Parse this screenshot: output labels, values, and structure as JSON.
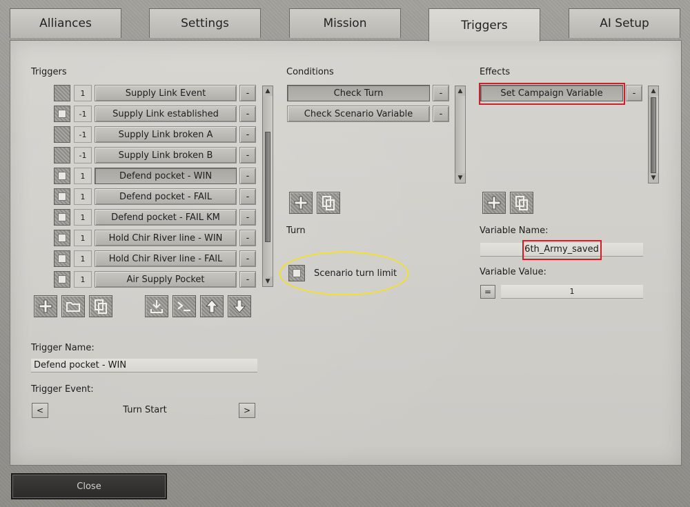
{
  "tabs": [
    {
      "label": "Alliances"
    },
    {
      "label": "Settings"
    },
    {
      "label": "Mission"
    },
    {
      "label": "Triggers",
      "active": true
    },
    {
      "label": "AI Setup"
    }
  ],
  "triggers": {
    "header": "Triggers",
    "rows": [
      {
        "checked": false,
        "count": "1",
        "name": "Supply Link Event",
        "remove": "-"
      },
      {
        "checked": true,
        "count": "-1",
        "name": "Supply Link established",
        "remove": "-"
      },
      {
        "checked": false,
        "count": "-1",
        "name": "Supply Link broken A",
        "remove": "-"
      },
      {
        "checked": false,
        "count": "-1",
        "name": "Supply Link broken B",
        "remove": "-"
      },
      {
        "checked": true,
        "count": "1",
        "name": "Defend pocket - WIN",
        "remove": "-",
        "selected": true
      },
      {
        "checked": true,
        "count": "1",
        "name": "Defend pocket - FAIL",
        "remove": "-"
      },
      {
        "checked": true,
        "count": "1",
        "name": "Defend pocket - FAIL KM",
        "remove": "-"
      },
      {
        "checked": true,
        "count": "1",
        "name": "Hold Chir River line  - WIN",
        "remove": "-"
      },
      {
        "checked": true,
        "count": "1",
        "name": "Hold Chir River line  - FAIL",
        "remove": "-"
      },
      {
        "checked": true,
        "count": "1",
        "name": "Air Supply Pocket",
        "remove": "-"
      }
    ],
    "toolbar_icons": [
      "add-icon",
      "folder-icon",
      "copy-icon",
      "import-icon",
      "console-icon",
      "move-up-icon",
      "move-down-icon"
    ],
    "trigger_name_label": "Trigger Name:",
    "trigger_name_value": "Defend pocket - WIN",
    "trigger_event_label": "Trigger Event:",
    "trigger_event_value": "Turn Start",
    "prev": "<",
    "next": ">"
  },
  "conditions": {
    "header": "Conditions",
    "rows": [
      {
        "name": "Check Turn",
        "remove": "-",
        "selected": true
      },
      {
        "name": "Check Scenario Variable",
        "remove": "-"
      }
    ],
    "section_label": "Turn",
    "turn_limit_label": "Scenario turn limit"
  },
  "effects": {
    "header": "Effects",
    "rows": [
      {
        "name": "Set Campaign Variable",
        "remove": "-",
        "selected": true
      }
    ],
    "variable_name_label": "Variable Name:",
    "variable_name_value": "6th_Army_saved",
    "variable_value_label": "Variable Value:",
    "operator": "=",
    "variable_value": "1"
  },
  "footer": {
    "close_label": "Close"
  },
  "colors": {
    "highlight_red": "#d21c28",
    "highlight_yellow": "#f2e032"
  }
}
